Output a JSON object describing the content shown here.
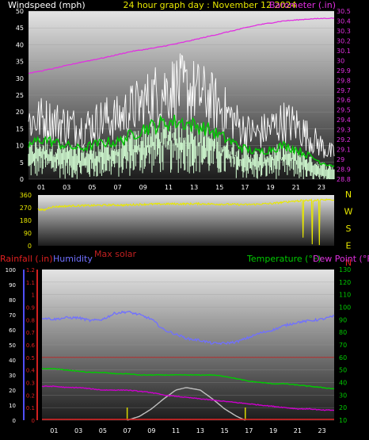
{
  "top": {
    "left_title": "Windspeed (mph)",
    "center_title": "24 hour graph day : November 12 2024",
    "right_title": "Barometer (.in)"
  },
  "direction": {
    "compass": [
      "N",
      "W",
      "S",
      "E",
      "N"
    ]
  },
  "bottom": {
    "rain_title": "Rainfall (.in)",
    "humidity_title": "Humidity",
    "solar_title": "Max solar",
    "temp_title": "Temperature (°F)",
    "dew_title": "Dew Point (°F)"
  },
  "colors": {
    "wind_max": "#ffffff",
    "wind_avg": "#00cc00",
    "wind_gust_fill": "#c8f0c8",
    "barometer": "#e030e0",
    "direction": "#e8e800",
    "humidity": "#7070ff",
    "rain": "#e02020",
    "temperature": "#00cc00",
    "dew_point": "#cc00cc",
    "solar": "#c0c0c0",
    "sun_marker": "#d8d800"
  },
  "chart_data": [
    {
      "type": "line",
      "title": "24 hour graph day : November 12 2024",
      "x_ticks": [
        "01",
        "03",
        "05",
        "07",
        "09",
        "11",
        "13",
        "15",
        "17",
        "19",
        "21",
        "23"
      ],
      "xlim": [
        0,
        24
      ],
      "y_left": {
        "label": "Windspeed (mph)",
        "ylim": [
          0,
          50
        ],
        "ticks": [
          0,
          5,
          10,
          15,
          20,
          25,
          30,
          35,
          40,
          45,
          50
        ]
      },
      "y_right": {
        "label": "Barometer (.in)",
        "ylim": [
          28.8,
          30.5
        ],
        "ticks": [
          "28.8",
          "28.9",
          "29",
          "29.1",
          "29.2",
          "29.3",
          "29.4",
          "29.5",
          "29.6",
          "29.7",
          "29.8",
          "29.9",
          "30",
          "30.1",
          "30.2",
          "30.3",
          "30.4",
          "30.5"
        ]
      },
      "series": [
        {
          "name": "Barometer (.in)",
          "axis": "right",
          "x": [
            0,
            2,
            4,
            6,
            8,
            10,
            12,
            14,
            16,
            18,
            20,
            22,
            24
          ],
          "values": [
            29.87,
            29.92,
            29.98,
            30.03,
            30.09,
            30.13,
            30.18,
            30.24,
            30.3,
            30.36,
            30.4,
            30.42,
            30.43
          ]
        },
        {
          "axis": "left",
          "role": "max",
          "x": [
            0,
            1,
            2,
            3,
            4,
            5,
            6,
            7,
            8,
            9,
            10,
            11,
            12,
            13,
            14,
            15,
            16,
            17,
            18,
            19,
            20,
            21,
            22,
            23,
            24
          ],
          "values": [
            19,
            20,
            19,
            18,
            17,
            18,
            20,
            20,
            23,
            25,
            28,
            30,
            30,
            29,
            27,
            24,
            20,
            16,
            15,
            17,
            19,
            18,
            14,
            11,
            8
          ]
        },
        {
          "axis": "left",
          "role": "avg",
          "x": [
            0,
            1,
            2,
            3,
            4,
            5,
            6,
            7,
            8,
            9,
            10,
            11,
            12,
            13,
            14,
            15,
            16,
            17,
            18,
            19,
            20,
            21,
            22,
            23,
            24
          ],
          "values": [
            10,
            12,
            11,
            10,
            9,
            10,
            11,
            11,
            13,
            15,
            16,
            17,
            17,
            16,
            15,
            13,
            11,
            9,
            8,
            9,
            10,
            9,
            7,
            5,
            4
          ]
        },
        {
          "axis": "left",
          "role": "min",
          "x": [
            0,
            1,
            2,
            3,
            4,
            5,
            6,
            7,
            8,
            9,
            10,
            11,
            12,
            13,
            14,
            15,
            16,
            17,
            18,
            19,
            20,
            21,
            22,
            23,
            24
          ],
          "values": [
            5,
            6,
            6,
            5,
            5,
            5,
            6,
            6,
            7,
            8,
            9,
            9,
            9,
            9,
            8,
            7,
            6,
            5,
            4,
            5,
            5,
            5,
            3,
            2,
            2
          ]
        }
      ]
    },
    {
      "type": "line",
      "y_left": {
        "ylim": [
          0,
          360
        ],
        "ticks": [
          0,
          90,
          180,
          270,
          360
        ]
      },
      "xlim": [
        0,
        24
      ],
      "series": [
        {
          "axis": "left",
          "x": [
            0,
            0.5,
            1,
            2,
            3,
            4,
            5,
            6,
            7,
            8,
            9,
            10,
            11,
            12,
            13,
            14,
            15,
            16,
            17,
            18,
            19,
            20,
            21,
            22,
            23,
            24
          ],
          "values": [
            260,
            252,
            275,
            280,
            284,
            285,
            287,
            290,
            288,
            293,
            295,
            296,
            297,
            297,
            298,
            296,
            295,
            293,
            292,
            296,
            300,
            310,
            318,
            322,
            325,
            328
          ]
        }
      ]
    },
    {
      "type": "line",
      "x_ticks": [
        "01",
        "03",
        "05",
        "07",
        "09",
        "11",
        "13",
        "15",
        "17",
        "19",
        "21",
        "23"
      ],
      "xlim": [
        0,
        24
      ],
      "y_humidity": {
        "label": "Humidity",
        "ylim": [
          0,
          100
        ],
        "ticks": [
          0,
          10,
          20,
          30,
          40,
          50,
          60,
          70,
          80,
          90,
          100
        ]
      },
      "y_rain": {
        "label": "Rainfall (.in)",
        "ylim": [
          0,
          1.2
        ],
        "ticks": [
          "0",
          "0.1",
          "0.2",
          "0.3",
          "0.4",
          "0.5",
          "0.6",
          "0.7",
          "0.8",
          "0.9",
          "1",
          "1.1",
          "1.2"
        ]
      },
      "y_temp": {
        "label": "Temperature (°F) / Dew Point (°F)",
        "ylim": [
          10,
          130
        ],
        "ticks": [
          10,
          20,
          30,
          40,
          50,
          60,
          70,
          80,
          90,
          100,
          110,
          120,
          130
        ]
      },
      "markers": {
        "sunrise_hour": 7.0,
        "sunset_hour": 16.7
      },
      "series": [
        {
          "name": "Humidity",
          "axis": "humidity",
          "x": [
            0,
            1,
            2,
            3,
            4,
            5,
            6,
            7,
            8,
            9,
            10,
            11,
            12,
            13,
            14,
            15,
            16,
            17,
            18,
            19,
            20,
            21,
            22,
            23,
            24
          ],
          "values": [
            68,
            67,
            68,
            68,
            66,
            67,
            71,
            72,
            70,
            67,
            60,
            57,
            54,
            53,
            51,
            51,
            52,
            55,
            58,
            60,
            63,
            65,
            66,
            67,
            69
          ]
        },
        {
          "name": "Temperature (°F)",
          "axis": "temp",
          "x": [
            0,
            1,
            2,
            3,
            4,
            5,
            6,
            7,
            8,
            9,
            10,
            11,
            12,
            13,
            14,
            15,
            16,
            17,
            18,
            19,
            20,
            21,
            22,
            23,
            24
          ],
          "values": [
            51,
            51,
            50,
            49,
            48,
            48,
            47,
            47,
            46,
            46,
            46,
            46,
            46,
            46,
            46,
            45,
            43,
            41,
            40,
            39,
            39,
            38,
            37,
            36,
            35
          ]
        },
        {
          "name": "Dew Point (°F)",
          "axis": "temp",
          "x": [
            0,
            1,
            2,
            3,
            4,
            5,
            6,
            7,
            8,
            9,
            10,
            11,
            12,
            13,
            14,
            15,
            16,
            17,
            18,
            19,
            20,
            21,
            22,
            23,
            24
          ],
          "values": [
            37,
            37,
            36,
            36,
            35,
            34,
            34,
            34,
            33,
            32,
            30,
            29,
            28,
            27,
            26,
            25,
            24,
            23,
            22,
            21,
            20,
            19,
            19,
            18,
            18
          ]
        },
        {
          "name": "Max solar",
          "axis": "temp",
          "x": [
            7,
            8,
            9,
            10,
            11,
            11.85,
            13,
            14,
            15,
            16,
            16.7
          ],
          "values": [
            10,
            13,
            19,
            27,
            34,
            36,
            34,
            27,
            19,
            13,
            10
          ]
        },
        {
          "name": "Rainfall (.in)",
          "axis": "rain",
          "x": [
            0,
            24
          ],
          "values": [
            0,
            0
          ]
        }
      ]
    }
  ]
}
